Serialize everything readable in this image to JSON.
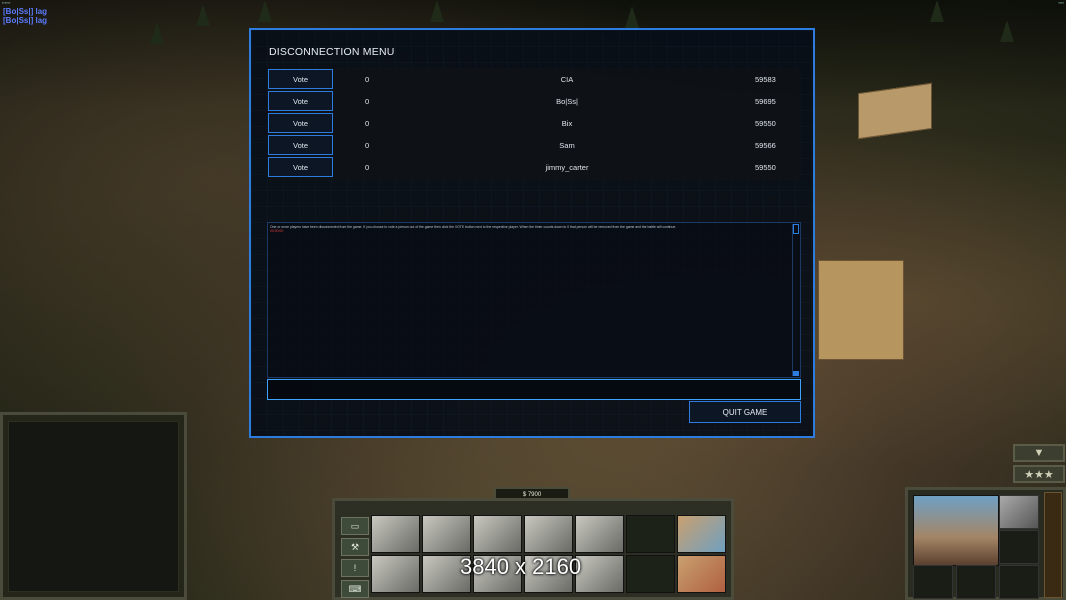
{
  "overlay": {
    "lag_messages": [
      "[Bo|Ss|] lag",
      "[Bo|Ss|] lag"
    ]
  },
  "dialog": {
    "title": "DISCONNECTION MENU",
    "players": [
      {
        "vote_label": "Vote",
        "votes": "0",
        "name": "CIA",
        "ping": "59583"
      },
      {
        "vote_label": "Vote",
        "votes": "0",
        "name": "Bo|Ss|",
        "ping": "59695"
      },
      {
        "vote_label": "Vote",
        "votes": "0",
        "name": "Bix",
        "ping": "59550"
      },
      {
        "vote_label": "Vote",
        "votes": "0",
        "name": "Sam",
        "ping": "59566"
      },
      {
        "vote_label": "Vote",
        "votes": "0",
        "name": "jimmy_carter",
        "ping": "59550"
      }
    ],
    "message": "One or more players have been disconnected from the game. If you choose to vote a person out of the game then click the VOTE button next to the respective player. When the timer counts down to 0 that person will be removed from the game and the battle will continue.",
    "message_highlight": "00:00:00",
    "chat_value": "",
    "quit_label": "QUIT GAME"
  },
  "hud": {
    "money": "$ 7900",
    "resolution_overlay": "3840 x 2160",
    "side_buttons": [
      "▭",
      "⚒",
      "!",
      "⌨"
    ]
  },
  "colors": {
    "accent": "#2d7de0",
    "lag_text": "#5b7cff",
    "dialog_bg": "#080e18"
  }
}
